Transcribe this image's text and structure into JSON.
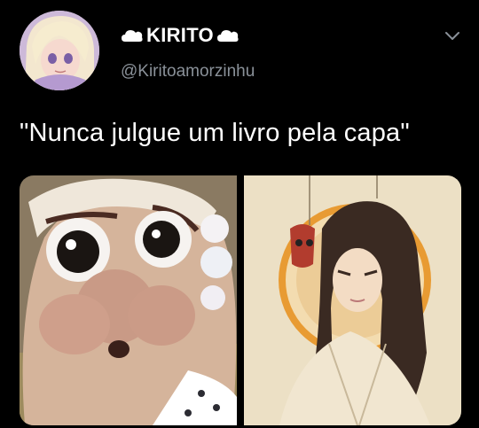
{
  "tweet": {
    "display_name": "KIRITO",
    "name_decoration_left_icon": "cloud-icon",
    "name_decoration_right_icon": "cloud-icon",
    "handle": "@Kiritoamorzinhu",
    "text": "\"Nunca julgue um livro pela capa\"",
    "menu_icon": "chevron-down-icon",
    "media": [
      {
        "alt_icon": "anime-old-woman-illustration"
      },
      {
        "alt_icon": "anime-long-haired-man-illustration"
      }
    ]
  },
  "colors": {
    "background": "#000000",
    "text_primary": "#ffffff",
    "text_secondary": "#8a9199"
  }
}
